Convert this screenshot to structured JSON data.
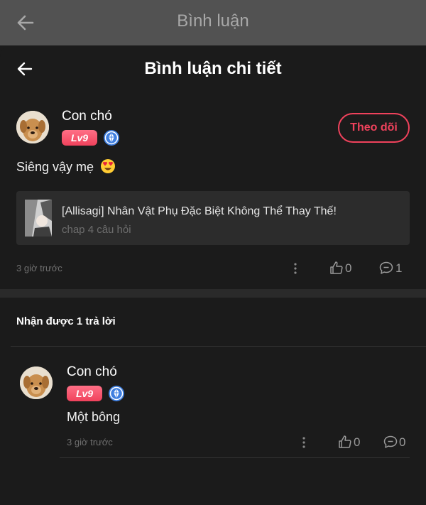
{
  "background_header": {
    "title": "Bình luận"
  },
  "sheet": {
    "title": "Bình luận chi tiết"
  },
  "comment": {
    "username": "Con chó",
    "level": "Lv9",
    "follow_label": "Theo dõi",
    "text": "Siêng vậy mẹ",
    "emoji": "heart-eyes-emoji",
    "manga": {
      "title": "[Allisagi] Nhân Vật Phụ Đặc Biệt Không Thể Thay Thế!",
      "subtitle": "chap 4 câu hỏi"
    },
    "time": "3 giờ trước",
    "likes": "0",
    "replies": "1"
  },
  "replies_header": "Nhận được 1 trả lời",
  "reply": {
    "username": "Con chó",
    "level": "Lv9",
    "text": "Một bông",
    "time": "3 giờ trước",
    "likes": "0",
    "replies": "0"
  },
  "colors": {
    "accent": "#f0425c",
    "background": "#1b1b1b",
    "card": "#2c2c2c",
    "muted_text": "#6f6f6f",
    "tier_icon": "#3f7fe0"
  },
  "icons": {
    "back": "arrow-left-icon",
    "tier": "sapphire-tier-icon",
    "more": "more-vertical-icon",
    "like": "thumbs-up-icon",
    "reply": "comment-icon"
  }
}
